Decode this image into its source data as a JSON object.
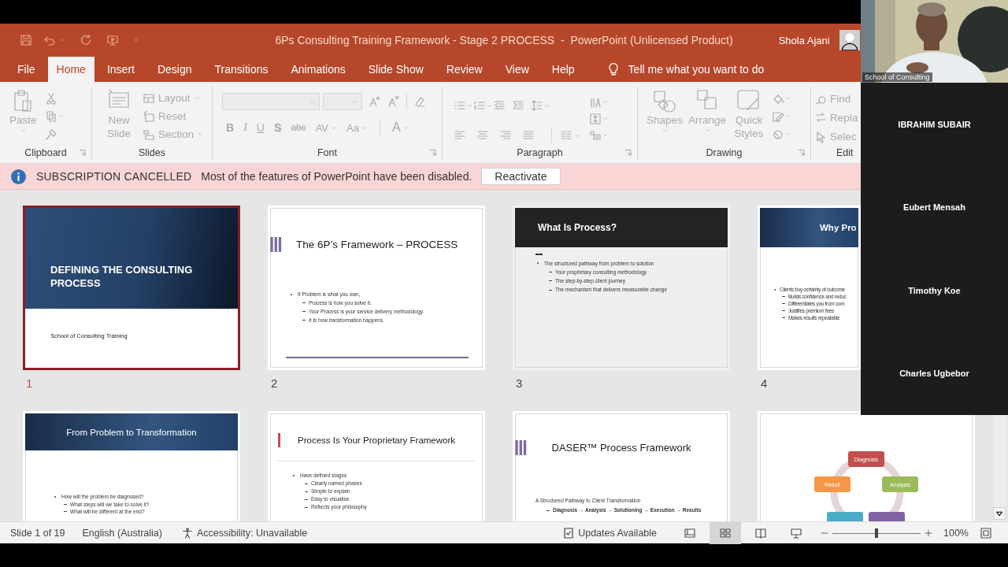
{
  "window": {
    "title": "6Ps Consulting Training Framework - Stage 2 PROCESS  -  PowerPoint (Unlicensed Product)",
    "user": "Shola Ajani"
  },
  "tabs": [
    {
      "label": "File",
      "selected": false
    },
    {
      "label": "Home",
      "selected": true
    },
    {
      "label": "Insert",
      "selected": false
    },
    {
      "label": "Design",
      "selected": false
    },
    {
      "label": "Transitions",
      "selected": false
    },
    {
      "label": "Animations",
      "selected": false
    },
    {
      "label": "Slide Show",
      "selected": false
    },
    {
      "label": "Review",
      "selected": false
    },
    {
      "label": "View",
      "selected": false
    },
    {
      "label": "Help",
      "selected": false
    }
  ],
  "tell_me": {
    "placeholder": "Tell me what you want to do"
  },
  "ribbon": {
    "disabled": true,
    "groups": [
      {
        "label": "Clipboard",
        "commands": [
          "Paste"
        ]
      },
      {
        "label": "Slides",
        "commands": [
          "New Slide",
          "Layout",
          "Reset",
          "Section"
        ]
      },
      {
        "label": "Font",
        "commands": [
          "B",
          "I",
          "U",
          "S",
          "abc",
          "AV",
          "Aa",
          "A"
        ]
      },
      {
        "label": "Paragraph"
      },
      {
        "label": "Drawing",
        "commands": [
          "Shapes",
          "Arrange",
          "Quick Styles"
        ]
      },
      {
        "label": "Edit",
        "commands": [
          "Find",
          "Repla",
          "Selec"
        ]
      }
    ]
  },
  "message_bar": {
    "title": "SUBSCRIPTION CANCELLED",
    "text": "Most of the features of PowerPoint have been disabled.",
    "button": "Reactivate"
  },
  "slides": [
    {
      "number": "1",
      "selected": true,
      "kind": "title",
      "title": "DEFINING THE CONSULTING PROCESS",
      "subtitle": "School of Consulting Training"
    },
    {
      "number": "2",
      "selected": false,
      "kind": "bars",
      "title": "The 6P’s Framework – PROCESS",
      "bullets": [
        {
          "text": "If Problem is what you own,",
          "children": [
            {
              "text": "Process is how you solve it."
            },
            {
              "text": "Your Process is your service delivery methodology."
            },
            {
              "text": "It is how transformation happens."
            }
          ]
        }
      ]
    },
    {
      "number": "3",
      "selected": false,
      "kind": "dark_header",
      "title": "What Is Process?",
      "bullets": [
        {
          "text": "The structured pathway from problem to solution",
          "children": [
            {
              "text": "Your proprietary consulting methodology"
            },
            {
              "text": "The step-by-step client journey"
            },
            {
              "text": "The mechanism that delivers measurable change"
            }
          ]
        }
      ]
    },
    {
      "number": "4",
      "selected": false,
      "kind": "blue_banner",
      "title": "Why Pro",
      "bullets": [
        {
          "text": "Clients buy certainty of outcome",
          "children": [
            {
              "text": "Builds confidence and reduc"
            },
            {
              "text": "Differentiates you from com"
            },
            {
              "text": "Justifies premium fees"
            },
            {
              "text": "Makes results repeatable"
            }
          ]
        }
      ]
    },
    {
      "selected": false,
      "kind": "blue_header",
      "title": "From Problem to Transformation",
      "bullets": [
        {
          "text": "How will the problem be diagnosed?",
          "children": [
            {
              "text": "What steps will we take to solve it?"
            },
            {
              "text": "What will be different at the end?"
            }
          ]
        }
      ]
    },
    {
      "selected": false,
      "kind": "red_bar",
      "title": "Process Is Your Proprietary Framework",
      "bullets": [
        {
          "text": "Have defined stages",
          "children": [
            {
              "text": "Clearly named phases"
            },
            {
              "text": "Simple to explain"
            },
            {
              "text": "Easy to visualise"
            },
            {
              "text": "Reflects your philosophy"
            }
          ]
        }
      ]
    },
    {
      "selected": false,
      "kind": "bars_center",
      "title": "DASER™ Process Framework",
      "bullets": [
        {
          "text": "A Structured Pathway to Client Transformation",
          "children": [
            {
              "text": "Diagnosis → Analysis → Solutioning → Execution → Results"
            }
          ]
        }
      ]
    },
    {
      "selected": false,
      "kind": "diagram",
      "nodes": [
        {
          "label": "Diagnosis",
          "color": "#c0504d"
        },
        {
          "label": "Result",
          "color": "#f79646"
        },
        {
          "label": "Analysis",
          "color": "#9bbb59"
        },
        {
          "color": "#4bacc6"
        },
        {
          "color": "#8064a2"
        }
      ]
    }
  ],
  "status_bar": {
    "slide": "Slide 1 of 19",
    "language": "English (Australia)",
    "accessibility": "Accessibility: Unavailable",
    "updates": "Updates Available",
    "views": [
      {
        "kind": "normal",
        "selected": false
      },
      {
        "kind": "sorter",
        "selected": true
      },
      {
        "kind": "reading",
        "selected": false
      },
      {
        "kind": "slideshow",
        "selected": false
      }
    ],
    "zoom": {
      "level": 0.5,
      "reading": "100%"
    }
  },
  "participants": [
    {
      "kind": "video",
      "name": "School of Consulting"
    },
    {
      "kind": "name",
      "name": "IBRAHIM SUBAIR"
    },
    {
      "kind": "name",
      "name": "Eubert Mensah"
    },
    {
      "kind": "name",
      "name": "Timothy Koe"
    },
    {
      "kind": "name",
      "name": "Charles Ugbebor"
    }
  ]
}
